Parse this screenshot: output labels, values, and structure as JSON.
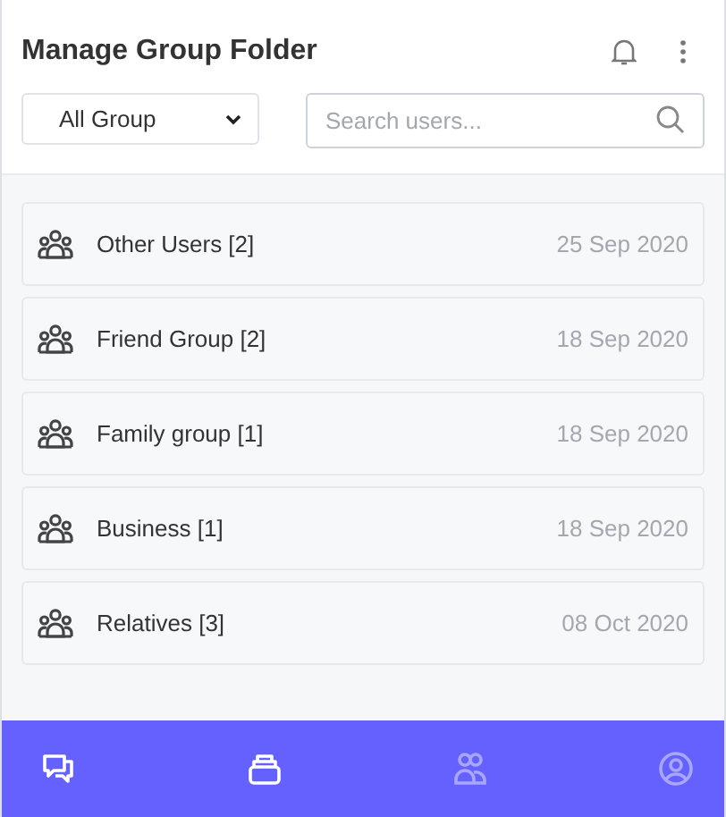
{
  "header": {
    "title": "Manage Group Folder"
  },
  "filter": {
    "value": "All Group"
  },
  "search": {
    "placeholder": "Search users..."
  },
  "groups": [
    {
      "name": "Other Users [2]",
      "date": "25 Sep 2020"
    },
    {
      "name": "Friend Group [2]",
      "date": "18 Sep 2020"
    },
    {
      "name": "Family group [1]",
      "date": "18 Sep 2020"
    },
    {
      "name": "Business [1]",
      "date": "18 Sep 2020"
    },
    {
      "name": "Relatives [3]",
      "date": "08 Oct 2020"
    }
  ],
  "nav": [
    {
      "kind": "chats",
      "dimmed": false
    },
    {
      "kind": "folders",
      "dimmed": false
    },
    {
      "kind": "contacts",
      "dimmed": true
    },
    {
      "kind": "profile",
      "dimmed": true
    }
  ]
}
